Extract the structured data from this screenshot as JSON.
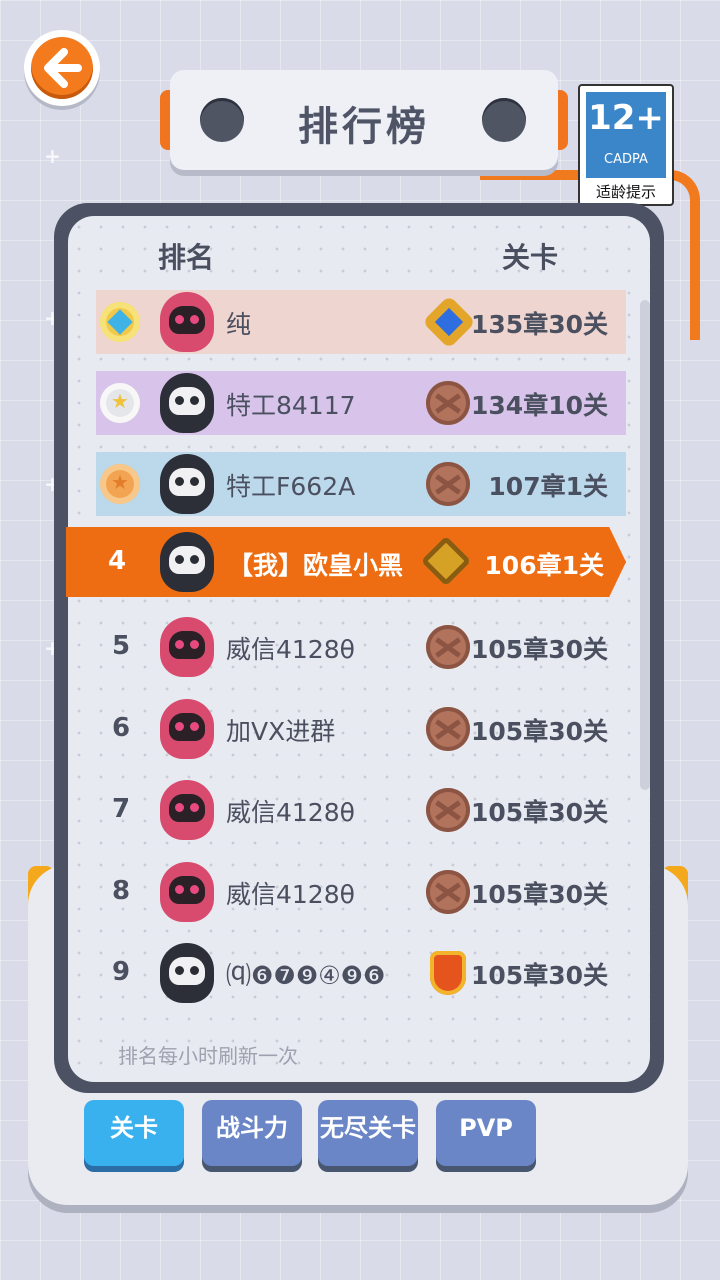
{
  "title": "排行榜",
  "age_badge": {
    "number": "12+",
    "org": "CADPA",
    "label": "适龄提示"
  },
  "headers": {
    "rank": "排名",
    "level": "关卡"
  },
  "rows": [
    {
      "rank": "",
      "name": "纯",
      "level": "135章30关",
      "color": "#eed5cf"
    },
    {
      "rank": "",
      "name": "特工84117",
      "level": "134章10关",
      "color": "#d8c4ea"
    },
    {
      "rank": "",
      "name": "特工F662A",
      "level": "107章1关",
      "color": "#bcd9ec"
    },
    {
      "rank": "4",
      "name": "【我】欧皇小黑",
      "level": "106章1关",
      "color": "#ef6d12"
    },
    {
      "rank": "5",
      "name": "威信4128θ",
      "level": "105章30关"
    },
    {
      "rank": "6",
      "name": "加VX进群",
      "level": "105章30关"
    },
    {
      "rank": "7",
      "name": "威信4128θ",
      "level": "105章30关"
    },
    {
      "rank": "8",
      "name": "威信4128θ",
      "level": "105章30关"
    },
    {
      "rank": "9",
      "name": "⒬❻❼❾④❾❻",
      "level": "105章30关"
    }
  ],
  "footer_note": "排名每小时刷新一次",
  "tabs": [
    "关卡",
    "战斗力",
    "无尽关卡",
    "PVP"
  ]
}
